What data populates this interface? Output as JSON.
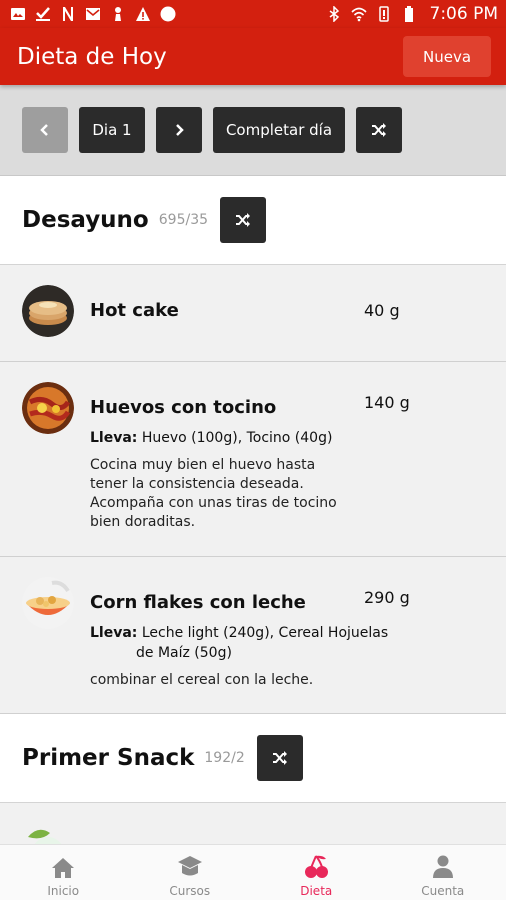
{
  "status_bar": {
    "time": "7:06 PM"
  },
  "app_bar": {
    "title": "Dieta de Hoy",
    "new_button": "Nueva"
  },
  "day_bar": {
    "day_label": "Dia 1",
    "complete_label": "Completar día"
  },
  "meals": [
    {
      "title": "Desayuno",
      "count": "695/35",
      "items": [
        {
          "name": "Hot cake",
          "qty": "40 g",
          "ingredients_label": "",
          "ingredients": "",
          "description": ""
        },
        {
          "name": "Huevos con tocino",
          "qty": "140 g",
          "ingredients_label": "Lleva:",
          "ingredients": "Huevo (100g), Tocino (40g)",
          "description": "Cocina muy bien el huevo hasta tener la consistencia deseada. Acompaña con unas tiras de tocino bien doraditas."
        },
        {
          "name": "Corn flakes con leche",
          "qty": "290 g",
          "ingredients_label": "Lleva:",
          "ingredients": "Leche light (240g), Cereal Hojuelas de Maíz (50g)",
          "description": "combinar el cereal con la leche."
        }
      ]
    },
    {
      "title": "Primer Snack",
      "count": "192/2"
    }
  ],
  "bottom_nav": [
    {
      "label": "Inicio",
      "icon": "home-icon"
    },
    {
      "label": "Cursos",
      "icon": "graduation-cap-icon"
    },
    {
      "label": "Dieta",
      "icon": "cherry-icon",
      "active": true
    },
    {
      "label": "Cuenta",
      "icon": "person-icon"
    }
  ],
  "colors": {
    "primary": "#d3200f",
    "active_nav": "#e8285a",
    "button_dark": "#2b2b2b"
  }
}
